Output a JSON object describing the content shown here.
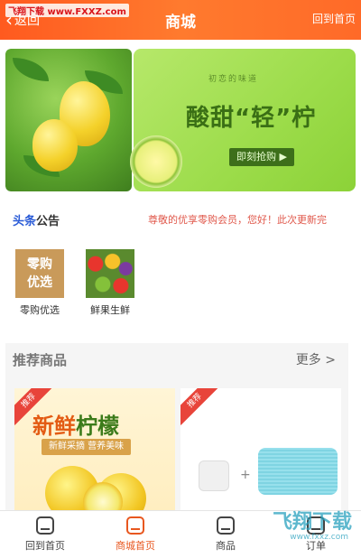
{
  "header": {
    "back_label": "返回",
    "title": "商城",
    "home_label": "回到首页",
    "watermark": "飞翔下载 www.FXXZ.com"
  },
  "banner": {
    "tag": "初恋的味道",
    "headline": "酸甜“轻”柠",
    "button": "即刻抢购 ▶"
  },
  "notice": {
    "label_prefix": "头条",
    "label_suffix": "公告",
    "text": "尊敬的优享零购会员，您好！此次更新完"
  },
  "entries": [
    {
      "icon_text": "零购\n优选",
      "label": "零购优选"
    },
    {
      "label": "鲜果生鲜"
    }
  ],
  "recommend": {
    "title": "推荐商品",
    "more": "更多 >",
    "cards": [
      {
        "badge": "推荐",
        "big_a": "新鲜",
        "big_b": "柠檬",
        "sub": "新鲜采摘 营养美味"
      },
      {
        "badge": "推荐"
      }
    ]
  },
  "tabbar": [
    {
      "label": "回到首页",
      "active": false
    },
    {
      "label": "商城首页",
      "active": true
    },
    {
      "label": "商品",
      "active": false
    },
    {
      "label": "订单",
      "active": false
    }
  ],
  "watermark_bottom": {
    "big": "飞翔下载",
    "small": "www.fxxz.com"
  },
  "colors": {
    "accent": "#ff6a28",
    "active_tab": "#e8571f",
    "notice_text": "#e0584b"
  }
}
